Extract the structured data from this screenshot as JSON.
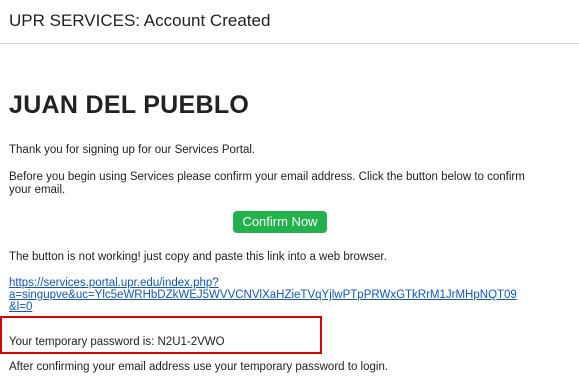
{
  "header": {
    "title": "UPR SERVICES: Account Created"
  },
  "email": {
    "name": "JUAN DEL PUEBLO",
    "thanks": "Thank you for signing up for our Services Portal.",
    "before": "Before you begin using Services please confirm your email address. Click the button below to confirm your email.",
    "confirm_button": "Confirm Now",
    "not_working": "The button is not working! just copy and paste this link into a web browser.",
    "link_line1": "https://services.portal.upr.edu/index.php?",
    "link_line2": "a=singupve&uc=Ylc5eWRHbDZkWEJ5WVVCNVlXaHZieTVqYjlwPTpPRWxGTkRrM1JrMHpNQT09",
    "link_line3": "&l=0",
    "password": "Your temporary password is: N2U1-2VWO",
    "after": "After confirming your email address use your temporary password to login."
  },
  "colors": {
    "button": "#22b24c",
    "link": "#1155cc",
    "highlight": "#e00000"
  }
}
